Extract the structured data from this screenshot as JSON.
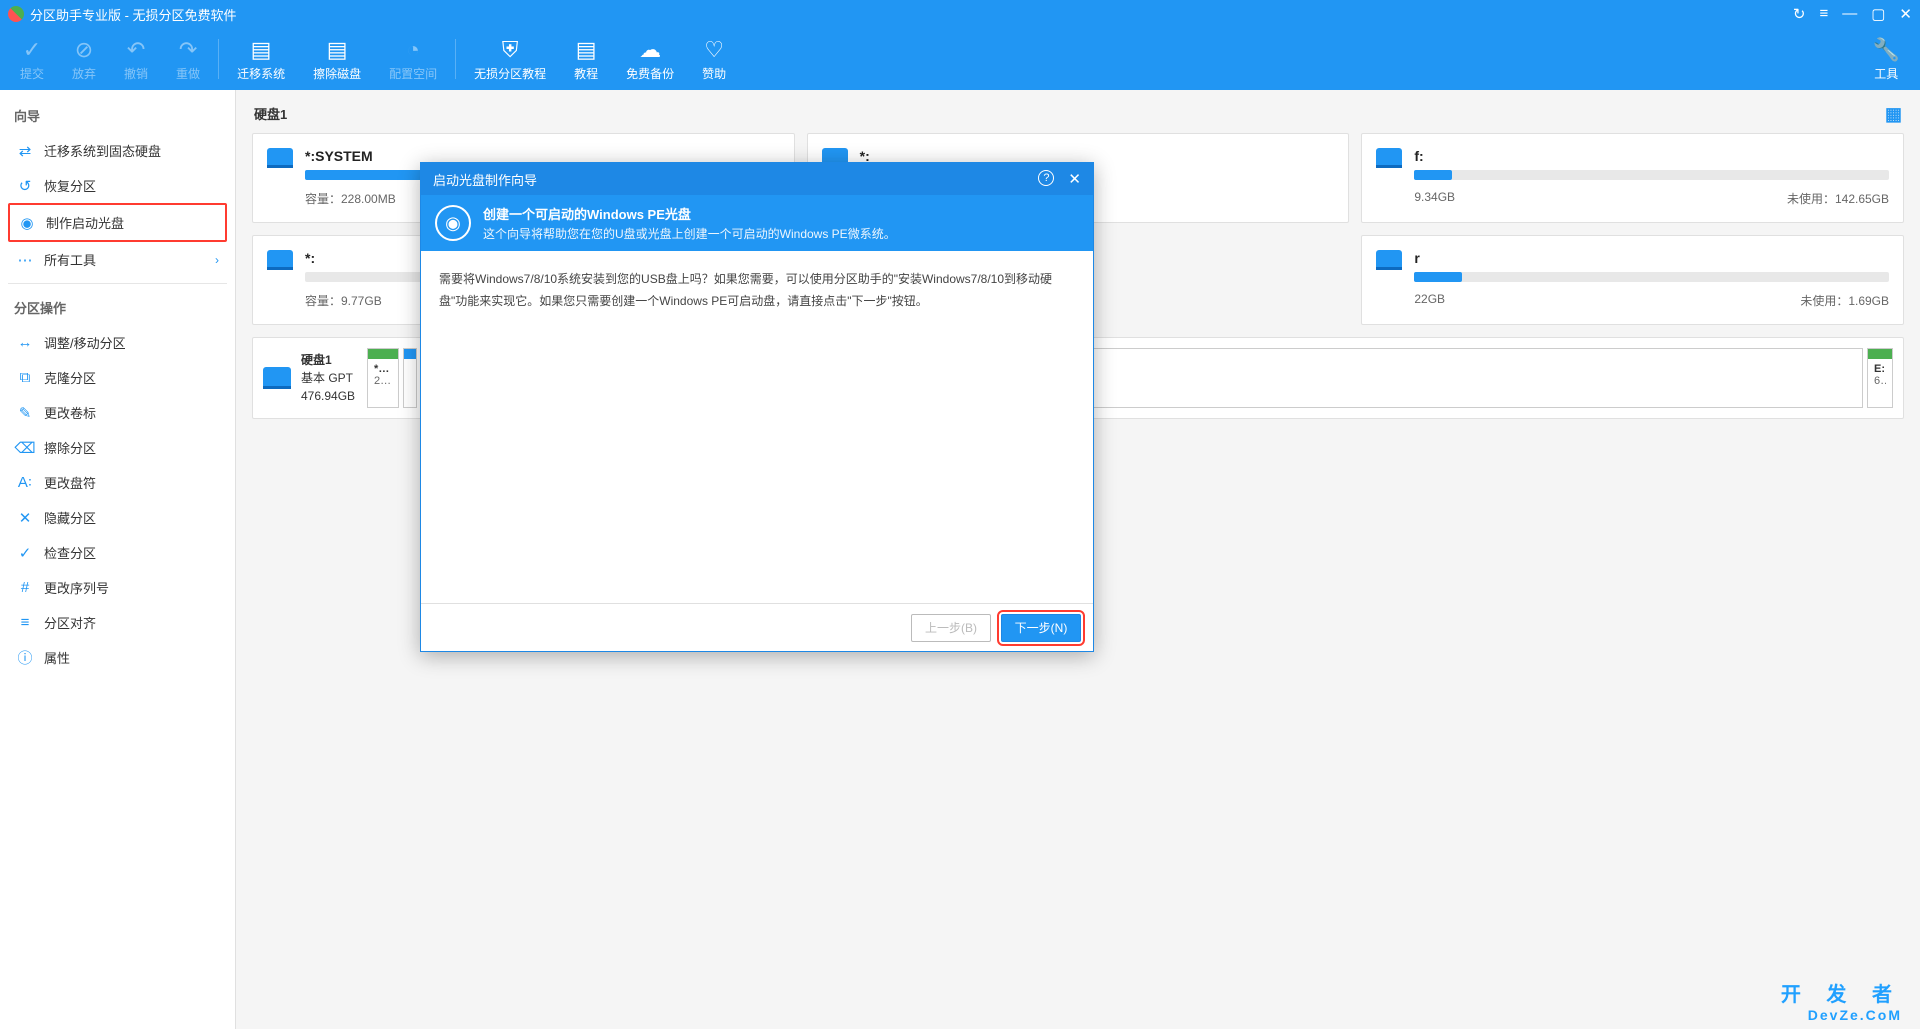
{
  "window": {
    "title": "分区助手专业版 - 无损分区免费软件",
    "controls": {
      "refresh": "↻",
      "menu": "≡",
      "min": "—",
      "max": "▢",
      "close": "✕"
    }
  },
  "toolbar": {
    "submit": "提交",
    "discard": "放弃",
    "undo": "撤销",
    "redo": "重做",
    "migrate": "迁移系统",
    "wipe": "擦除磁盘",
    "config": "配置空间",
    "tutorial": "无损分区教程",
    "tutorial2": "教程",
    "backup": "免费备份",
    "donate": "赞助",
    "tools": "工具"
  },
  "sidebar": {
    "wizardTitle": "向导",
    "wizardItems": [
      {
        "icon": "⇄",
        "label": "迁移系统到固态硬盘"
      },
      {
        "icon": "↺",
        "label": "恢复分区"
      },
      {
        "icon": "◉",
        "label": "制作启动光盘",
        "selected": true
      },
      {
        "icon": "⋯",
        "label": "所有工具",
        "chevron": true
      }
    ],
    "opsTitle": "分区操作",
    "opsItems": [
      {
        "icon": "↔",
        "label": "调整/移动分区"
      },
      {
        "icon": "⧉",
        "label": "克隆分区"
      },
      {
        "icon": "✎",
        "label": "更改卷标"
      },
      {
        "icon": "⌫",
        "label": "擦除分区"
      },
      {
        "icon": "A꞉",
        "label": "更改盘符"
      },
      {
        "icon": "✕",
        "label": "隐藏分区"
      },
      {
        "icon": "✓",
        "label": "检查分区"
      },
      {
        "icon": "#",
        "label": "更改序列号"
      },
      {
        "icon": "≡",
        "label": "分区对齐"
      },
      {
        "icon": "ⓘ",
        "label": "属性"
      }
    ]
  },
  "content": {
    "diskLabel": "硬盘1",
    "partitions": [
      {
        "name": "*:SYSTEM",
        "capacity": "容量：228.00MB",
        "unused": "",
        "fill": 95
      },
      {
        "name": "*:",
        "capacity": "",
        "unused": "",
        "fill": 0
      },
      {
        "name": "f:",
        "capacity": "9.34GB",
        "unused": "未使用：142.65GB",
        "fill": 8
      }
    ],
    "partitions2": [
      {
        "name": "*:",
        "capacity": "容量：9.77GB",
        "unused": "",
        "fill": 0
      },
      {
        "name": "r",
        "capacity": "22GB",
        "unused": "未使用：1.69GB",
        "fill": 10
      }
    ],
    "diskStrip": {
      "diskName": "硬盘1",
      "diskType": "基本 GPT",
      "diskSize": "476.94GB",
      "seg1": {
        "name": "*:…",
        "val": "22…"
      },
      "segE": {
        "name": "E:",
        "val": "6…"
      }
    }
  },
  "dialog": {
    "title": "启动光盘制作向导",
    "headerTitle": "创建一个可启动的Windows PE光盘",
    "headerSub": "这个向导将帮助您在您的U盘或光盘上创建一个可启动的Windows PE微系统。",
    "body": "需要将Windows7/8/10系统安装到您的USB盘上吗？如果您需要，可以使用分区助手的\"安装Windows7/8/10到移动硬盘\"功能来实现它。如果您只需要创建一个Windows PE可启动盘，请直接点击\"下一步\"按钮。",
    "prevBtn": "上一步(B)",
    "nextBtn": "下一步(N)",
    "helpIcon": "?",
    "closeIcon": "✕"
  },
  "watermark": {
    "main": "开 发 者",
    "sub": "DevZe.CoM"
  }
}
